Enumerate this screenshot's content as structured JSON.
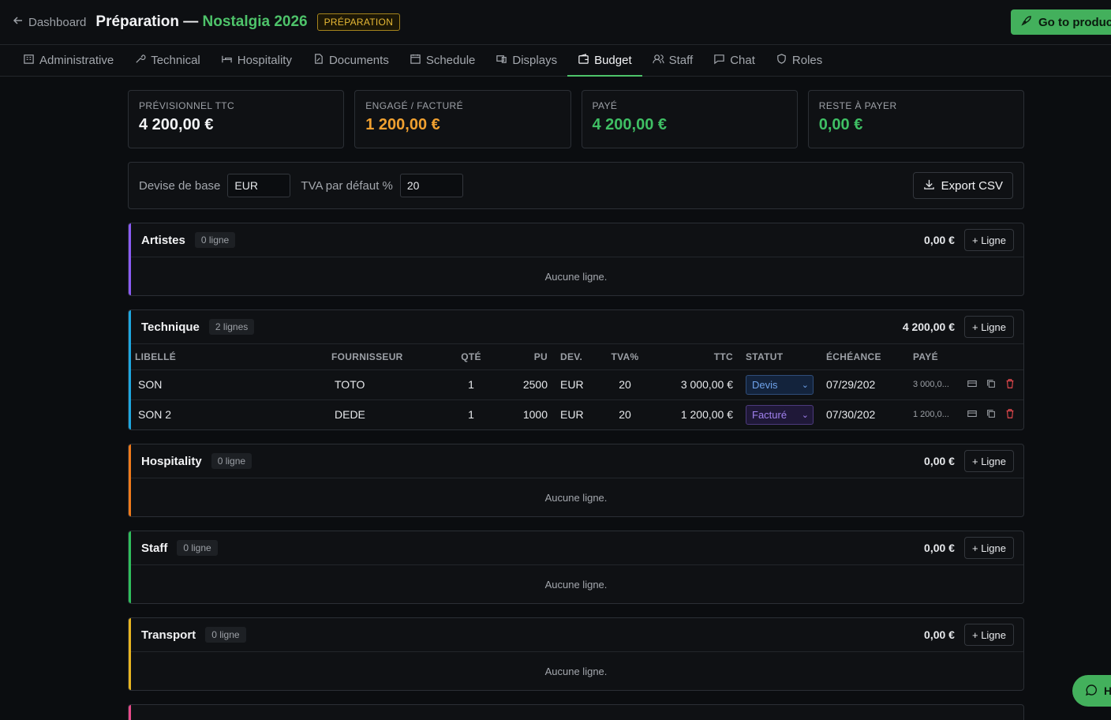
{
  "header": {
    "back_label": "Dashboard",
    "title_prefix": "Préparation —",
    "event_name": "Nostalgia 2026",
    "phase_badge": "PRÉPARATION",
    "go_button": "Go to product"
  },
  "tabs": [
    {
      "label": "Administrative",
      "icon": "building-icon"
    },
    {
      "label": "Technical",
      "icon": "wrench-icon"
    },
    {
      "label": "Hospitality",
      "icon": "bed-icon"
    },
    {
      "label": "Documents",
      "icon": "file-edit-icon"
    },
    {
      "label": "Schedule",
      "icon": "calendar-icon"
    },
    {
      "label": "Displays",
      "icon": "display-icon"
    },
    {
      "label": "Budget",
      "icon": "wallet-icon",
      "active": true
    },
    {
      "label": "Staff",
      "icon": "users-icon"
    },
    {
      "label": "Chat",
      "icon": "message-icon"
    },
    {
      "label": "Roles",
      "icon": "shield-icon"
    }
  ],
  "summary": [
    {
      "label": "PRÉVISIONNEL TTC",
      "value": "4 200,00 €",
      "color": "#f2f3f5"
    },
    {
      "label": "ENGAGÉ / FACTURÉ",
      "value": "1 200,00 €",
      "color": "#f0a030"
    },
    {
      "label": "PAYÉ",
      "value": "4 200,00 €",
      "color": "#3fbf64"
    },
    {
      "label": "RESTE À PAYER",
      "value": "0,00 €",
      "color": "#3fbf64"
    }
  ],
  "settings": {
    "currency_label": "Devise de base",
    "currency_value": "EUR",
    "vat_label": "TVA par défaut %",
    "vat_value": "20",
    "export_label": "Export CSV"
  },
  "add_line_label": "+ Ligne",
  "empty_label": "Aucune ligne.",
  "sections": {
    "artistes": {
      "name": "Artistes",
      "count": "0 ligne",
      "total": "0,00 €",
      "accent": "#8b5cf6"
    },
    "technique": {
      "name": "Technique",
      "count": "2 lignes",
      "total": "4 200,00 €",
      "accent": "#1ea7e0"
    },
    "hospitality": {
      "name": "Hospitality",
      "count": "0 ligne",
      "total": "0,00 €",
      "accent": "#f07a1a"
    },
    "staff": {
      "name": "Staff",
      "count": "0 ligne",
      "total": "0,00 €",
      "accent": "#2fbf5c"
    },
    "transport": {
      "name": "Transport",
      "count": "0 ligne",
      "total": "0,00 €",
      "accent": "#e8b520"
    }
  },
  "table": {
    "columns": [
      "LIBELLÉ",
      "FOURNISSEUR",
      "QTÉ",
      "PU",
      "DEV.",
      "TVA%",
      "TTC",
      "STATUT",
      "ÉCHÉANCE",
      "PAYÉ"
    ],
    "rows": [
      {
        "label": "SON",
        "supplier": "TOTO",
        "qty": "1",
        "pu": "2500",
        "dev": "EUR",
        "tva": "20",
        "ttc": "3 000,00 €",
        "status": "Devis",
        "due": "07/29/202",
        "paid": "3 000,0..."
      },
      {
        "label": "SON 2",
        "supplier": "DEDE",
        "qty": "1",
        "pu": "1000",
        "dev": "EUR",
        "tva": "20",
        "ttc": "1 200,00 €",
        "status": "Facturé",
        "due": "07/30/202",
        "paid": "1 200,0..."
      }
    ]
  },
  "chat_fab_label": "H"
}
